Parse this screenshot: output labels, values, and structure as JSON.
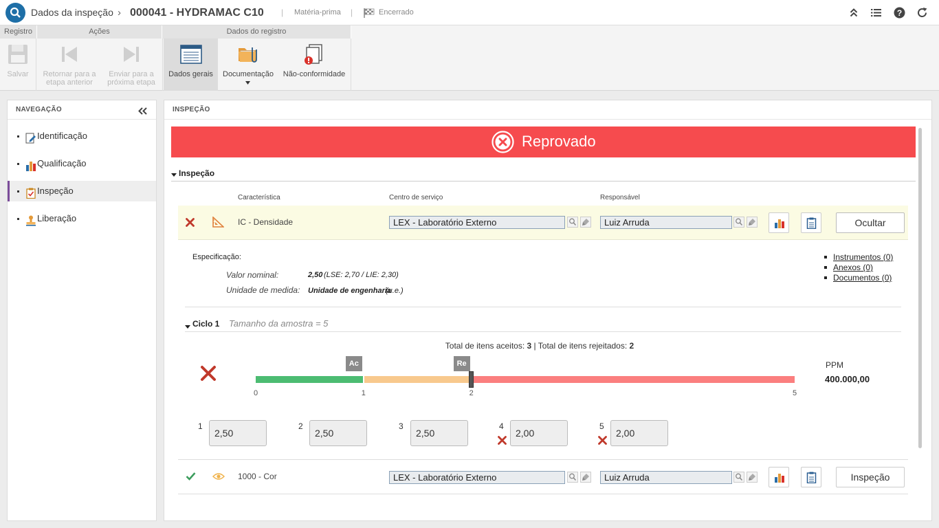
{
  "header": {
    "page": "Dados da inspeção",
    "record": "000041 - HYDRAMAC C10",
    "category": "Matéria-prima",
    "status": "Encerrado",
    "icons": [
      "collapse-up-icon",
      "list-icon",
      "help-icon",
      "refresh-icon"
    ]
  },
  "ribbon": {
    "groups": {
      "registro": "Registro",
      "acoes": "Ações",
      "dados": "Dados do registro"
    },
    "save": "Salvar",
    "back": [
      "Retornar para a",
      "etapa anterior"
    ],
    "forward": [
      "Enviar para a",
      "próxima etapa"
    ],
    "general": "Dados gerais",
    "docs": "Documentação",
    "nc": "Não-conformidade"
  },
  "nav": {
    "title": "NAVEGAÇÃO",
    "items": [
      {
        "label": "Identificação",
        "icon": "edit-icon"
      },
      {
        "label": "Qualificação",
        "icon": "bar-chart-icon"
      },
      {
        "label": "Inspeção",
        "icon": "clipboard-check-icon",
        "active": true
      },
      {
        "label": "Liberação",
        "icon": "stamp-icon"
      }
    ]
  },
  "main": {
    "title": "INSPEÇÃO",
    "banner": "Reprovado",
    "banner_color": "#f64b4e",
    "section": "Inspeção",
    "columns": {
      "char": "Característica",
      "center": "Centro de serviço",
      "resp": "Responsável"
    },
    "row1": {
      "name": "IC - Densidade",
      "center": "LEX - Laboratório Externo",
      "resp": "Luiz Arruda",
      "button": "Ocultar"
    },
    "spec": {
      "title": "Especificação:",
      "nominal_label": "Valor nominal:",
      "nominal_value": "2,50",
      "nominal_limits": "(LSE: 2,70 / LIE: 2,30)",
      "unit_label": "Unidade de medida:",
      "unit_value": "Unidade de engenharia",
      "unit_abbr": "(u.e.)"
    },
    "links": [
      "Instrumentos (0)",
      "Anexos (0)",
      "Documentos (0)"
    ],
    "cycle": {
      "title": "Ciclo 1",
      "sample": "Tamanho da amostra = 5",
      "totals_pre": "Total de itens aceitos: ",
      "accepted": "3",
      "totals_mid": " | Total de itens rejeitados: ",
      "rejected": "2",
      "ac_label": "Ac",
      "re_label": "Re",
      "scale": {
        "min": 0,
        "ac": 1,
        "re": 2,
        "max": 5
      },
      "ticks": [
        "0",
        "1",
        "2",
        "5"
      ],
      "ppm_label": "PPM",
      "ppm_value": "400.000,00"
    },
    "samples": [
      {
        "n": "1",
        "value": "2,50",
        "fail": false
      },
      {
        "n": "2",
        "value": "2,50",
        "fail": false
      },
      {
        "n": "3",
        "value": "2,50",
        "fail": false
      },
      {
        "n": "4",
        "value": "2,00",
        "fail": true
      },
      {
        "n": "5",
        "value": "2,00",
        "fail": true
      }
    ],
    "row2": {
      "name": "1000 - Cor",
      "center": "LEX - Laboratório Externo",
      "resp": "Luiz Arruda",
      "button": "Inspeção"
    }
  }
}
